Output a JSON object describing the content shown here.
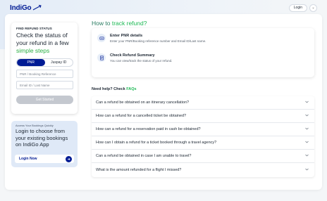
{
  "header": {
    "logo_text": "IndiGo",
    "login_label": "Login",
    "menu_chevron": "chevron-down-icon"
  },
  "status_card": {
    "label": "FIND REFUND STATUS",
    "heading_1": "Check the status of your",
    "heading_2": "refund in a few ",
    "heading_highlight": "simple steps",
    "toggle": [
      {
        "label": "PNR",
        "active": true
      },
      {
        "label": "Juspay ID",
        "active": false
      }
    ],
    "pnr_placeholder": "PNR / Booking Reference",
    "email_placeholder": "Email ID / Last Name",
    "submit_label": "Get Started"
  },
  "login_card": {
    "label": "Access Your Bookings Quickly",
    "heading": "Login to choose from your existing bookings on IndiGo App",
    "cta": "Login Now"
  },
  "how_to": {
    "title_prefix": "How to ",
    "title_highlight": "track refund?",
    "steps": [
      {
        "icon": "pnr-icon",
        "title": "Enter PNR details",
        "desc": "Enter your PNR/Booking reference number and Email ID/Last name."
      },
      {
        "icon": "summary-icon",
        "title": "Check Refund Summary",
        "desc": "You can view/track the status of your refund."
      }
    ]
  },
  "faq": {
    "title_prefix": "Need help? Check ",
    "title_highlight": "FAQs",
    "items": [
      "Can a refund be obtained on an itinerary cancellation?",
      "How can a refund for a cancelled ticket be obtained?",
      "How can a refund for a reservation paid in cash be obtained?",
      "How can I obtain a refund for a ticket booked through a travel agency?",
      "Can a refund be obtained in case I am unable to travel?",
      "What is the amount refunded for a flight I missed?"
    ]
  },
  "colors": {
    "brand": "#001b94",
    "accent": "#1db954"
  }
}
